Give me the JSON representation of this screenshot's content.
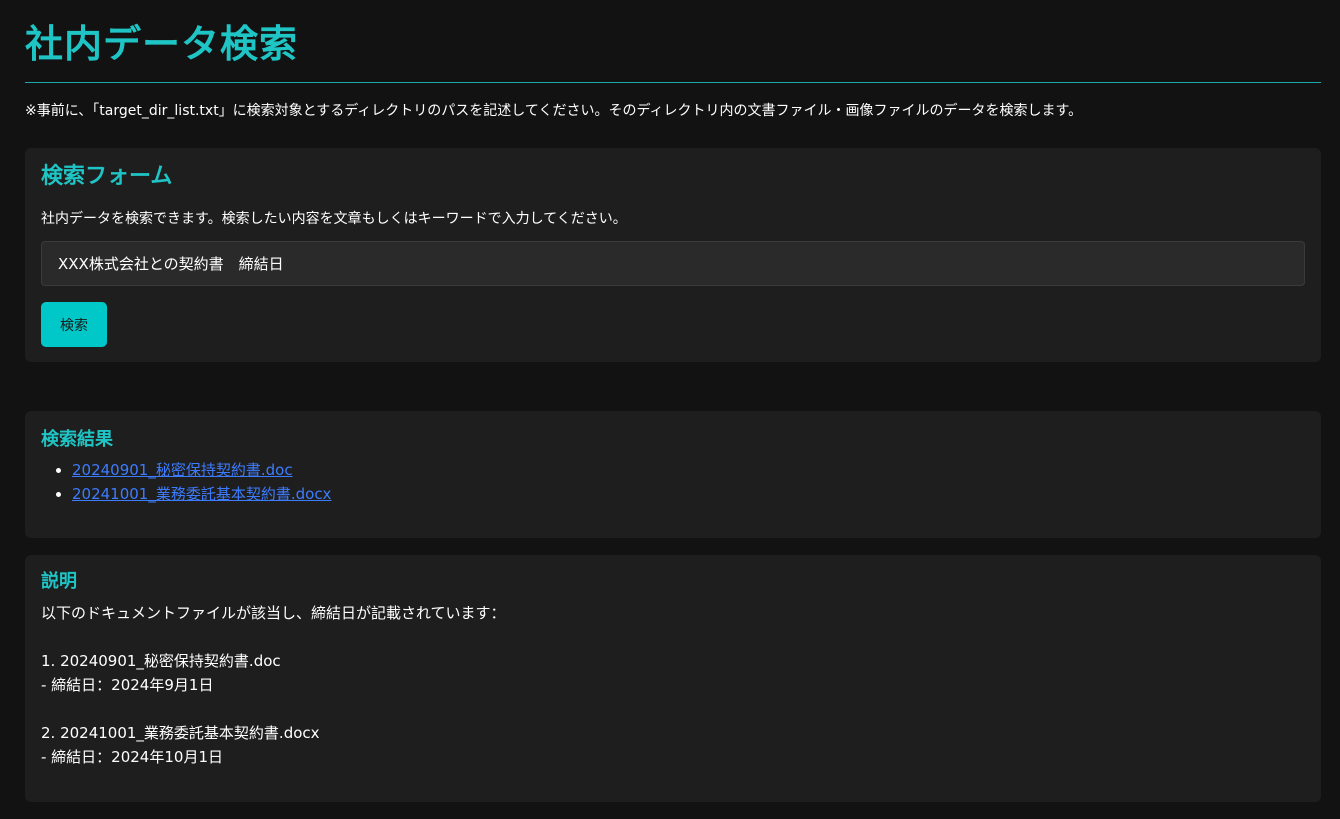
{
  "page": {
    "title": "社内データ検索",
    "notice": "※事前に、「target_dir_list.txt」に検索対象とするディレクトリのパスを記述してください。そのディレクトリ内の文書ファイル・画像ファイルのデータを検索します。"
  },
  "search_form": {
    "heading": "検索フォーム",
    "description": "社内データを検索できます。検索したい内容を文章もしくはキーワードで入力してください。",
    "query_value": "XXX株式会社との契約書　締結日",
    "button_label": "検索"
  },
  "results": {
    "heading": "検索結果",
    "items": [
      {
        "label": "20240901_秘密保持契約書.doc"
      },
      {
        "label": "20241001_業務委託基本契約書.docx"
      }
    ]
  },
  "explanation": {
    "heading": "説明",
    "body": "以下のドキュメントファイルが該当し、締結日が記載されています：\n\n1. 20240901_秘密保持契約書.doc\n- 締結日：2024年9月1日\n\n2. 20241001_業務委託基本契約書.docx\n- 締結日：2024年10月1日"
  },
  "colors": {
    "accent": "#1fc4c4",
    "button": "#00c8c8",
    "link": "#3d7cff",
    "background": "#121212",
    "panel": "#1e1e1e"
  }
}
